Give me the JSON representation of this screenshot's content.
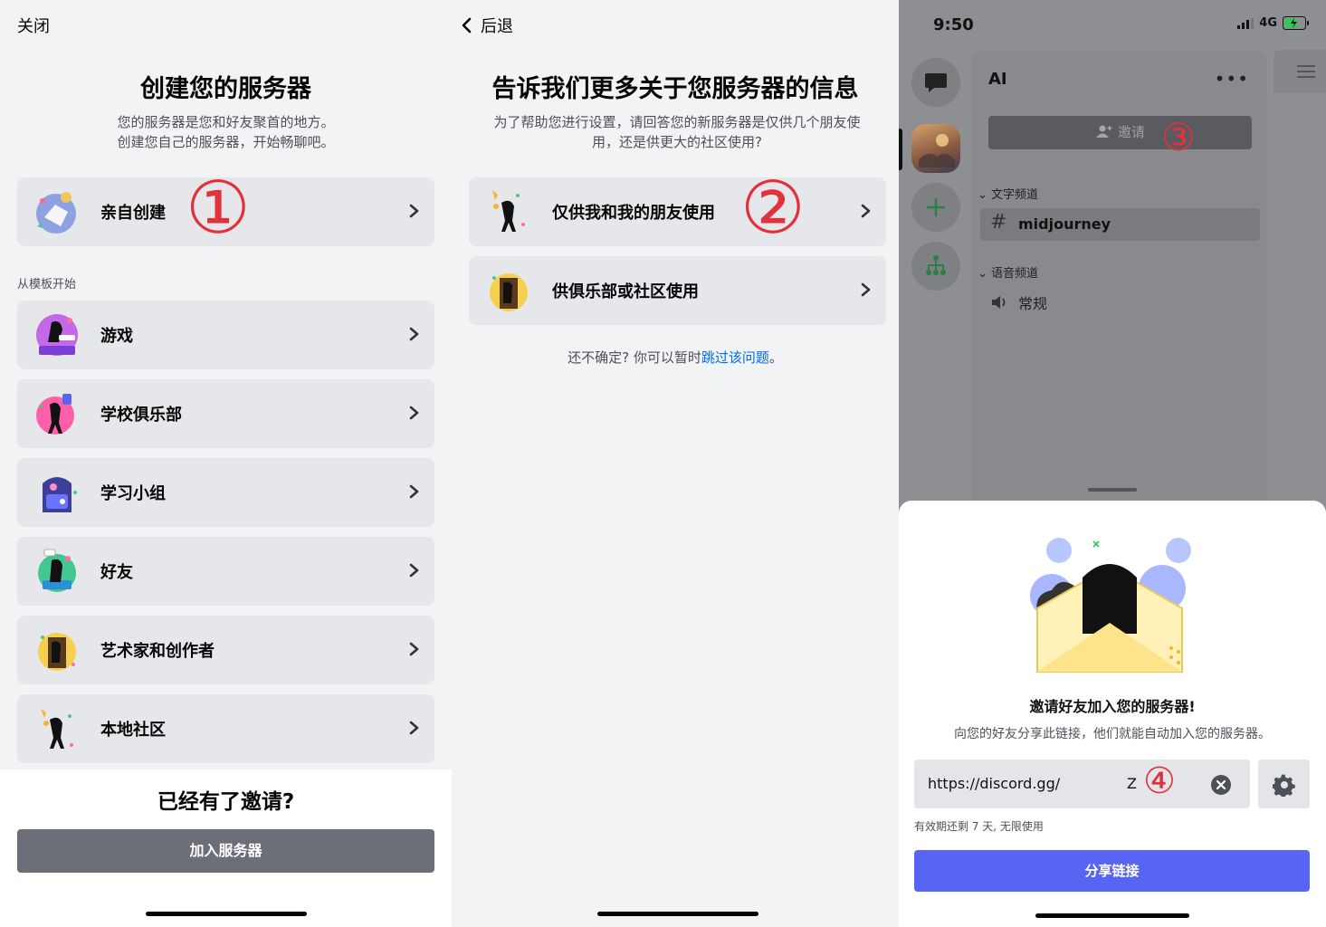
{
  "panel1": {
    "close_label": "关闭",
    "title": "创建您的服务器",
    "subtitle_line1": "您的服务器是您和好友聚首的地方。",
    "subtitle_line2": "创建您自己的服务器，开始畅聊吧。",
    "create_own_label": "亲自创建",
    "annotation_1": "①",
    "template_section": "从模板开始",
    "templates": [
      {
        "label": "游戏",
        "icon": "gaming-icon"
      },
      {
        "label": "学校俱乐部",
        "icon": "school-club-icon"
      },
      {
        "label": "学习小组",
        "icon": "study-group-icon"
      },
      {
        "label": "好友",
        "icon": "friends-icon"
      },
      {
        "label": "艺术家和创作者",
        "icon": "artists-icon"
      },
      {
        "label": "本地社区",
        "icon": "local-community-icon"
      }
    ],
    "invite_question": "已经有了邀请?",
    "join_button": "加入服务器"
  },
  "panel2": {
    "back_label": "后退",
    "title": "告诉我们更多关于您服务器的信息",
    "subtitle_line1": "为了帮助您进行设置，请回答您的新服务器是仅供几个朋友使",
    "subtitle_line2": "用，还是供更大的社区使用?",
    "option_friends": "仅供我和我的朋友使用",
    "option_community": "供俱乐部或社区使用",
    "annotation_2": "②",
    "skip_prefix": "还不确定? 你可以暂时",
    "skip_link": "跳过该问题",
    "skip_suffix": "。"
  },
  "panel3": {
    "status_time": "9:50",
    "network": "4G",
    "server_name": "AI",
    "invite_label": "邀请",
    "annotation_3": "③",
    "text_category": "文字频道",
    "text_channel": "midjourney",
    "voice_category": "语音频道",
    "voice_channel": "常规",
    "sheet_title": "邀请好友加入您的服务器!",
    "sheet_subtitle": "向您的好友分享此链接，他们就能自动加入您的服务器。",
    "invite_url": "https://discord.gg/",
    "invite_url_tail": "Z",
    "annotation_4": "④",
    "expire_text": "有效期还剩 7 天, 无限使用",
    "share_button": "分享链接"
  },
  "colors": {
    "accent": "#5865f2",
    "annotation": "#e1313a",
    "link": "#006ce7",
    "join_button": "#6d6f78"
  }
}
